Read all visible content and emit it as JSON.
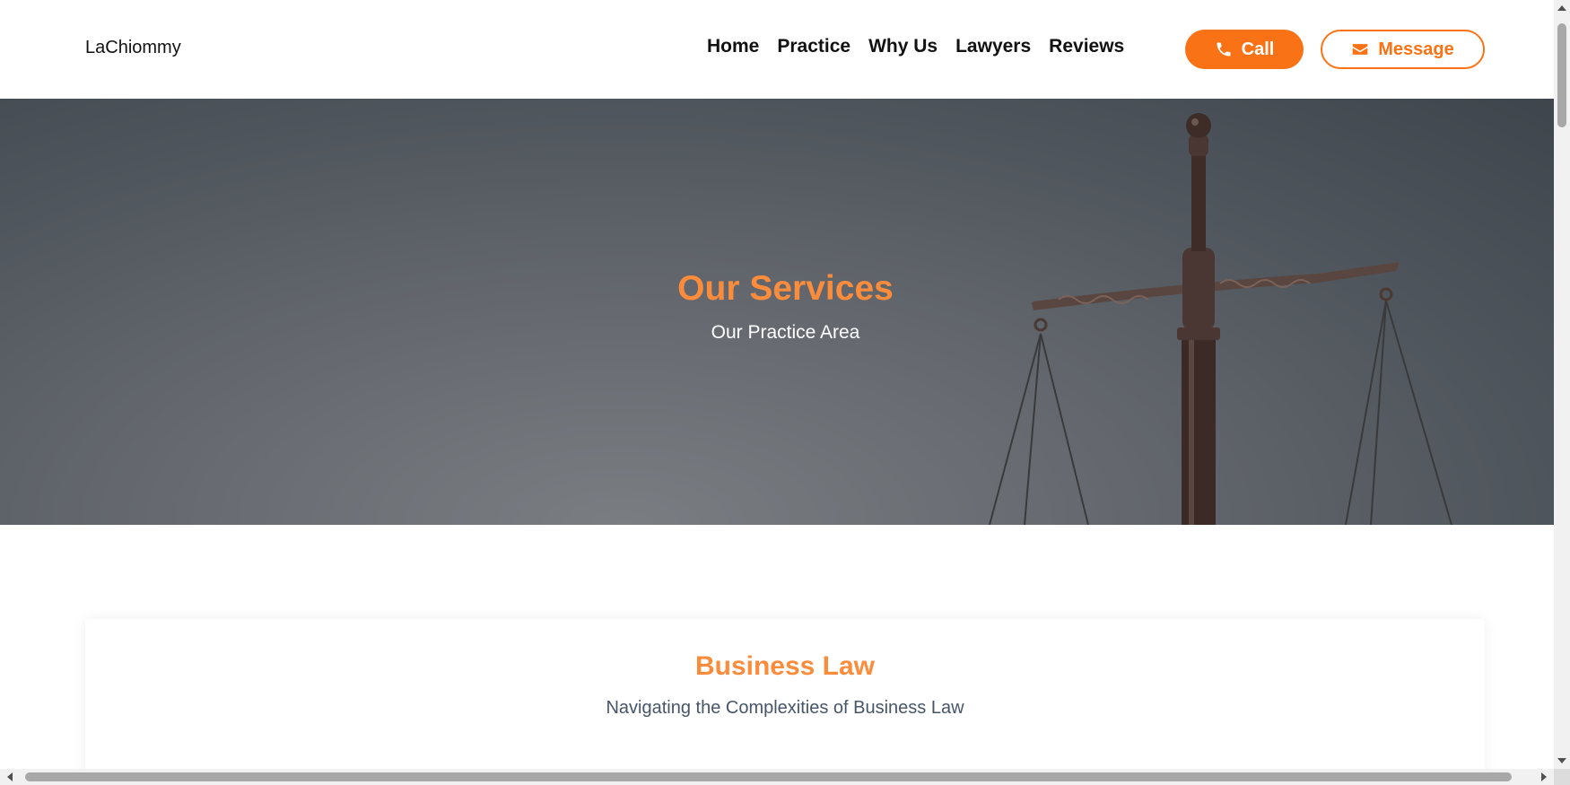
{
  "header": {
    "brand": "LaChiommy",
    "nav": [
      {
        "label": "Home"
      },
      {
        "label": "Practice"
      },
      {
        "label": "Why Us"
      },
      {
        "label": "Lawyers"
      },
      {
        "label": "Reviews"
      }
    ],
    "call_label": "Call",
    "message_label": "Message"
  },
  "hero": {
    "title": "Our Services",
    "subtitle": "Our Practice Area",
    "image": "scales-of-justice"
  },
  "services": [
    {
      "title": "Business Law",
      "subtitle": "Navigating the Complexities of Business Law"
    }
  ],
  "colors": {
    "accent": "#f97316",
    "accent_text": "#fb8c3c",
    "hero_bg": "#5f646a"
  },
  "icons": {
    "call": "phone-icon",
    "message": "envelope-icon"
  }
}
